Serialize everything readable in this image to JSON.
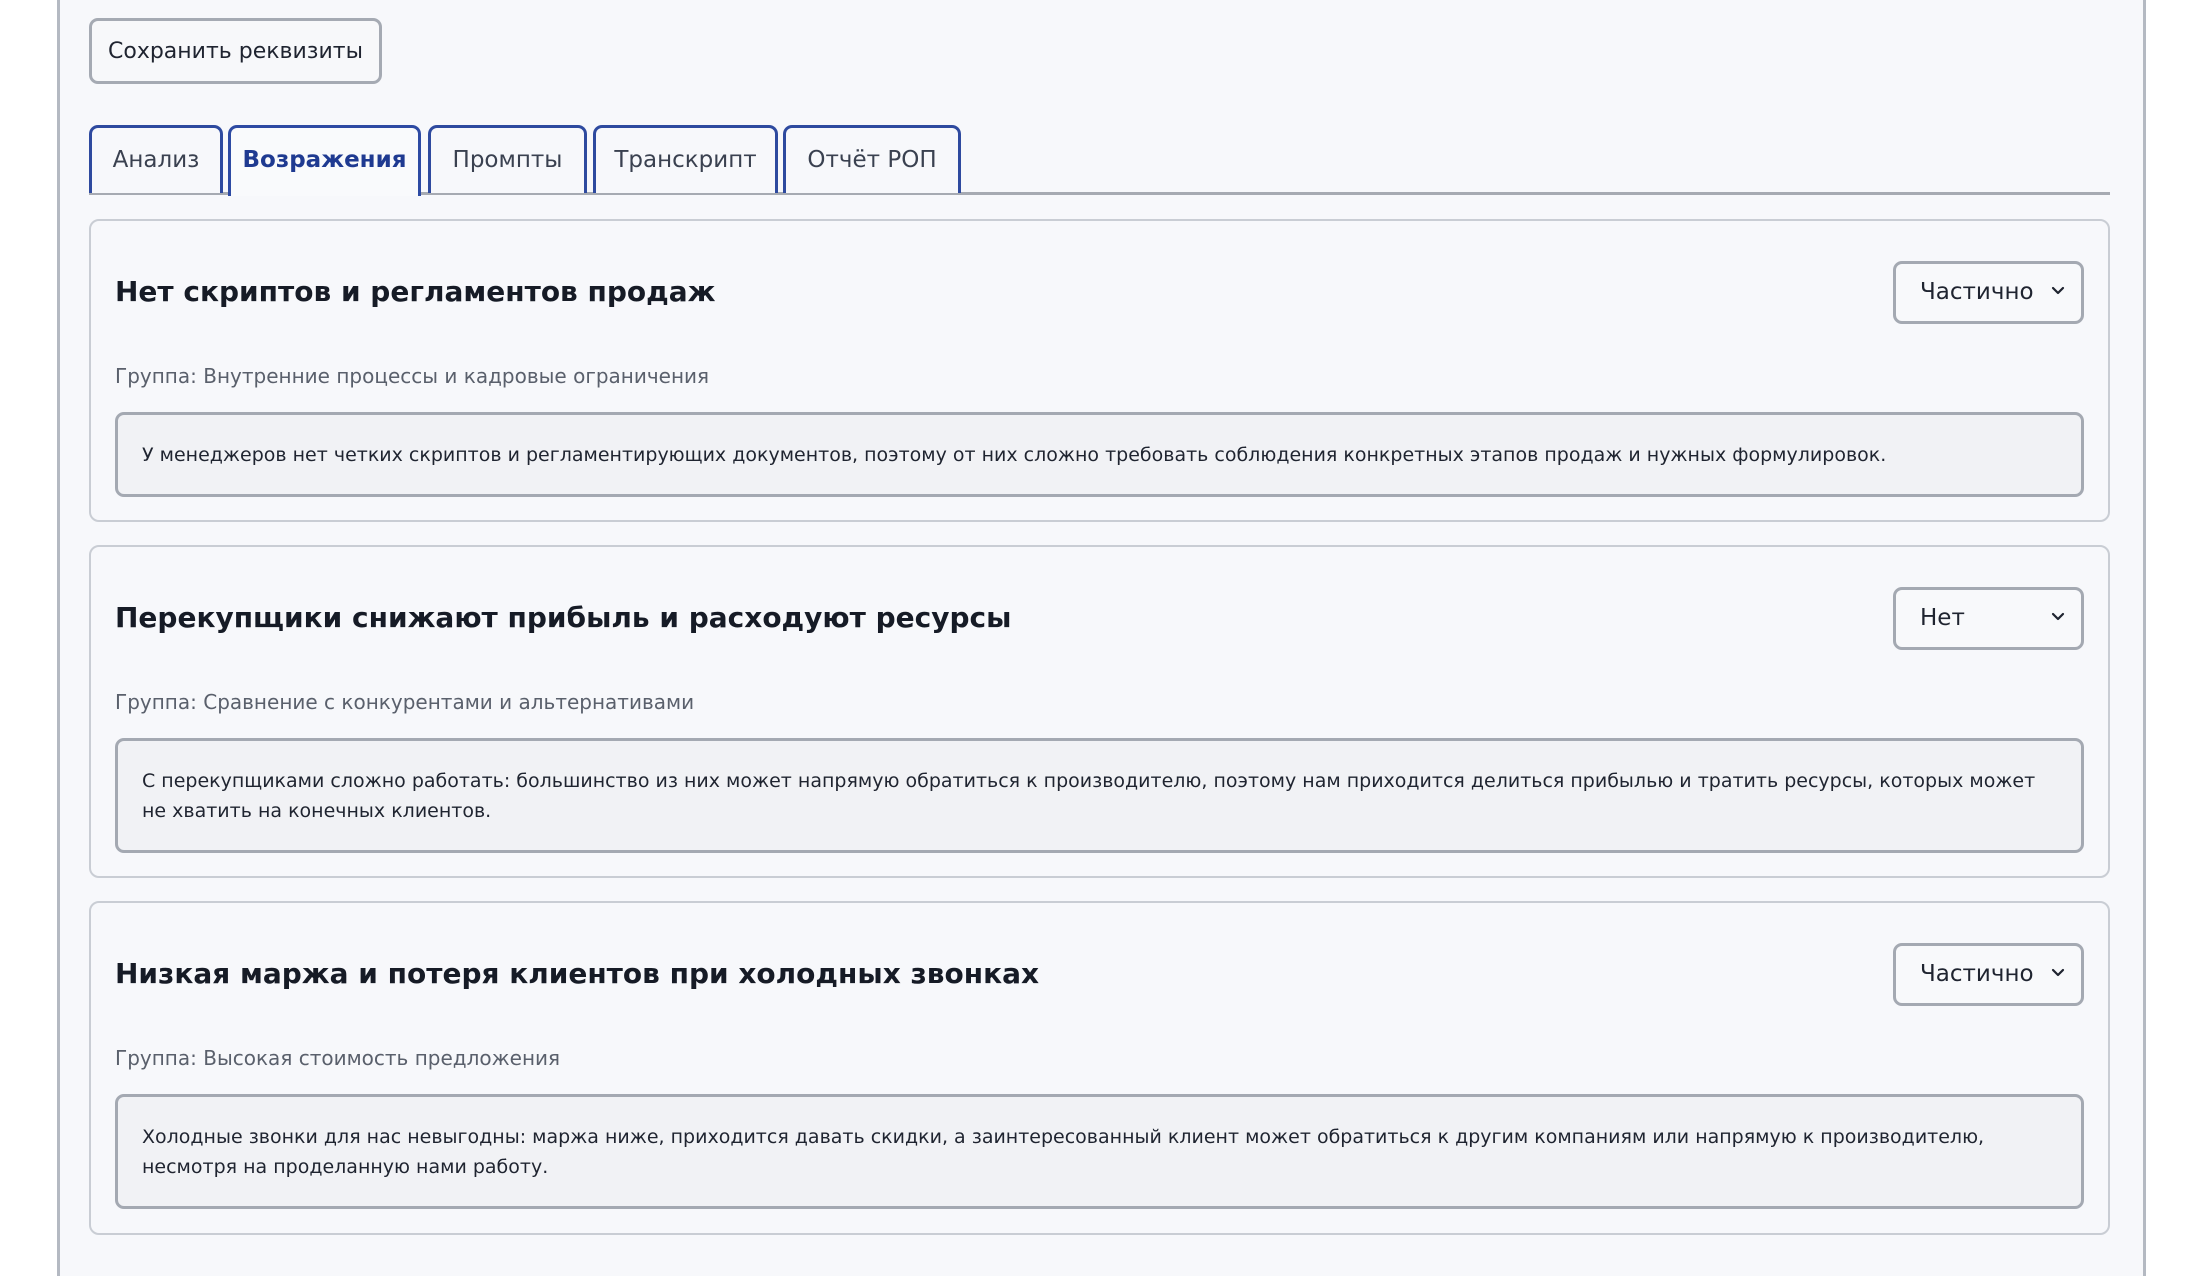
{
  "toolbar": {
    "save_label": "Сохранить реквизиты"
  },
  "tabs": [
    {
      "label": "Анализ",
      "active": false
    },
    {
      "label": "Возражения",
      "active": true
    },
    {
      "label": "Промпты",
      "active": false
    },
    {
      "label": "Транскрипт",
      "active": false
    },
    {
      "label": "Отчёт РОП",
      "active": false
    }
  ],
  "objections": [
    {
      "title": "Нет скриптов и регламентов продаж",
      "status": "Частично",
      "group": "Группа: Внутренние процессы и кадровые ограничения",
      "description": "У менеджеров нет четких скриптов и регламентирующих документов, поэтому от них сложно требовать соблюдения конкретных этапов продаж и нужных формулировок."
    },
    {
      "title": "Перекупщики снижают прибыль и расходуют ресурсы",
      "status": "Нет",
      "group": "Группа: Сравнение с конкурентами и альтернативами",
      "description": "С перекупщиками сложно работать: большинство из них может напрямую обратиться к производителю, поэтому нам приходится делиться прибылью и тратить ресурсы, которых может не хватить на конечных клиентов."
    },
    {
      "title": "Низкая маржа и потеря клиентов при холодных звонках",
      "status": "Частично",
      "group": "Группа: Высокая стоимость предложения",
      "description": "Холодные звонки для нас невыгодны: маржа ниже, приходится давать скидки, а заинтересованный клиент может обратиться к другим компаниям или напрямую к производителю, несмотря на проделанную нами работу."
    }
  ]
}
